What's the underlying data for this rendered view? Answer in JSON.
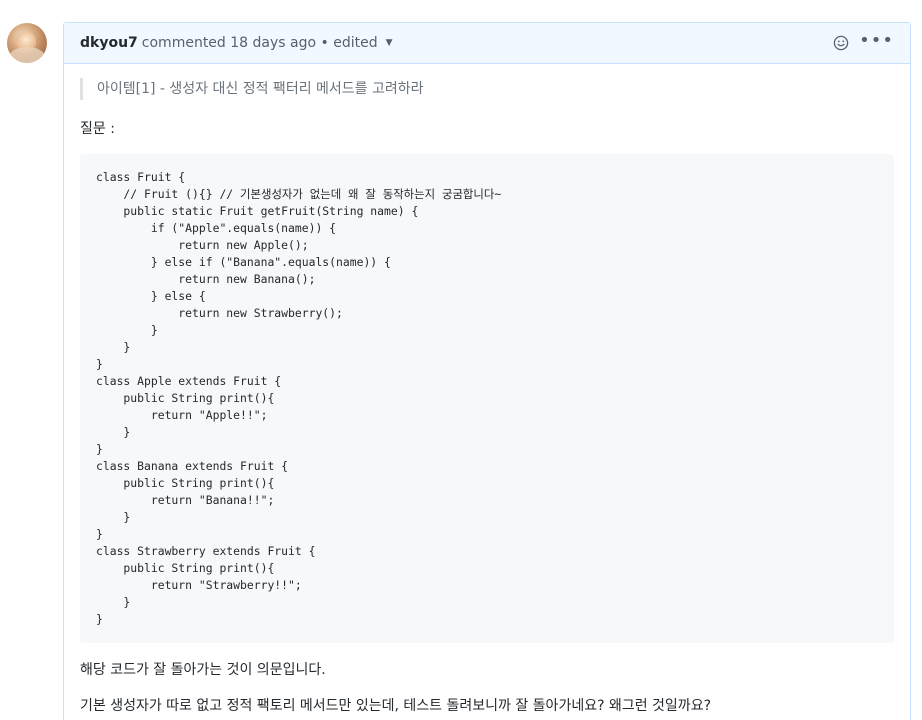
{
  "comment": {
    "author": "dkyou7",
    "meta": "commented 18 days ago • edited",
    "icons": {
      "reaction": "smiley-icon",
      "more": "kebab-icon",
      "dropdown": "caret-down-icon"
    },
    "quote": "아이템[1] - 생성자 대신 정적 팩터리 메서드를 고려하라",
    "question_label": "질문 :",
    "code": "class Fruit {\n    // Fruit (){} // 기본생성자가 없는데 왜 잘 동작하는지 궁굼합니다~\n    public static Fruit getFruit(String name) {\n        if (\"Apple\".equals(name)) {\n            return new Apple();\n        } else if (\"Banana\".equals(name)) {\n            return new Banana();\n        } else {\n            return new Strawberry();\n        }\n    }\n}\nclass Apple extends Fruit {\n    public String print(){\n        return \"Apple!!\";\n    }\n}\nclass Banana extends Fruit {\n    public String print(){\n        return \"Banana!!\";\n    }\n}\nclass Strawberry extends Fruit {\n    public String print(){\n        return \"Strawberry!!\";\n    }\n}",
    "paragraph_1": "해당 코드가 잘 돌아가는 것이 의문입니다.",
    "paragraph_2": "기본 생성자가 따로 없고 정적 팩토리 메서드만 있는데, 테스트 돌려보니까 잘 돌아가네요? 왜그런 것일까요?"
  },
  "colors": {
    "header_bg": "#f1f8ff",
    "border": "#c8e1ff",
    "code_bg": "#f6f8fa",
    "muted_text": "#586069"
  }
}
